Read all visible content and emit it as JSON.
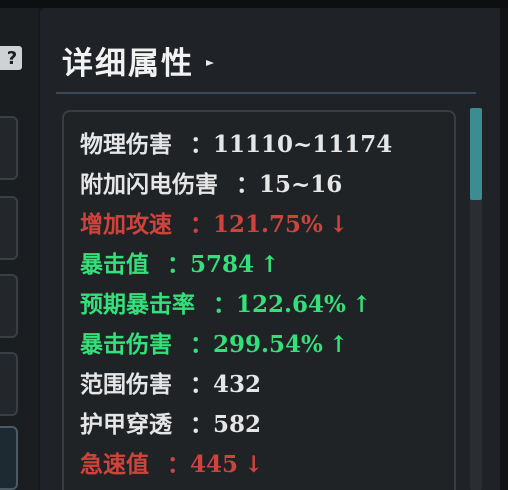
{
  "panel": {
    "title": "详细属性"
  },
  "help_icon": "?",
  "stats": [
    {
      "label": "物理伤害",
      "sep": "：",
      "value": "11110~11174",
      "arrow": "",
      "color": "#e6e6e6"
    },
    {
      "label": "附加闪电伤害",
      "sep": "：",
      "value": "15~16",
      "arrow": "",
      "color": "#e6e6e6"
    },
    {
      "label": "增加攻速",
      "sep": "：",
      "value": "121.75%",
      "arrow": "↓",
      "color": "#d0433c"
    },
    {
      "label": "暴击值",
      "sep": "：",
      "value": "5784",
      "arrow": "↑",
      "color": "#33e07a"
    },
    {
      "label": "预期暴击率",
      "sep": "：",
      "value": "122.64%",
      "arrow": "↑",
      "color": "#33e07a"
    },
    {
      "label": "暴击伤害",
      "sep": "：",
      "value": "299.54%",
      "arrow": "↑",
      "color": "#33e07a"
    },
    {
      "label": "范围伤害",
      "sep": "：",
      "value": "432",
      "arrow": "",
      "color": "#e6e6e6"
    },
    {
      "label": "护甲穿透",
      "sep": "：",
      "value": "582",
      "arrow": "",
      "color": "#e6e6e6"
    },
    {
      "label": "急速值",
      "sep": "：",
      "value": "445",
      "arrow": "↓",
      "color": "#d0433c"
    }
  ],
  "scrollbar": {
    "thumb_color": "#3b8d93"
  }
}
